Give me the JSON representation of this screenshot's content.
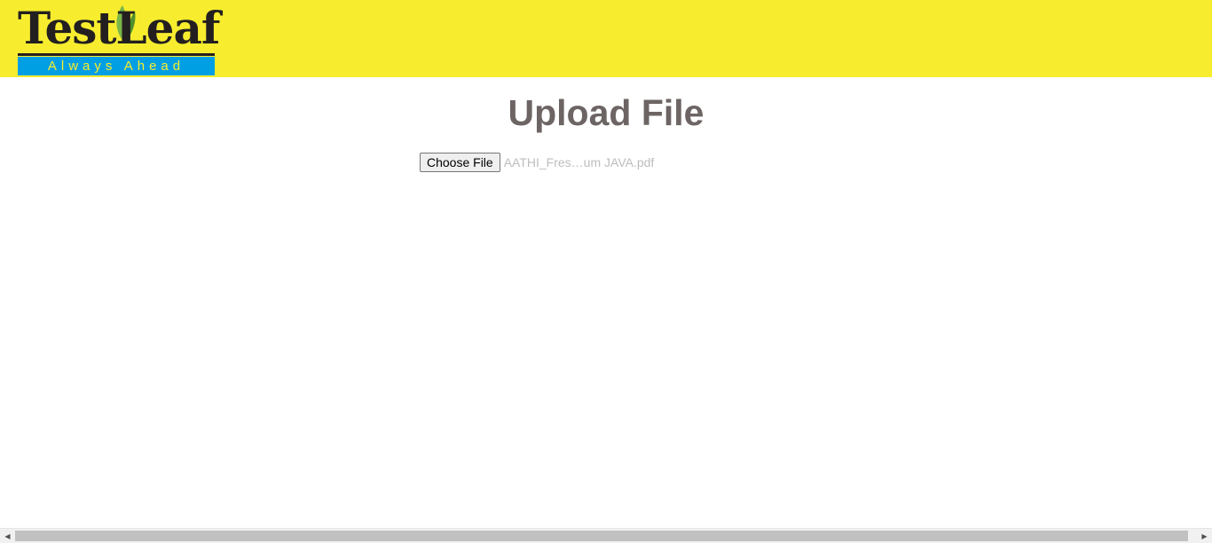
{
  "header": {
    "logo": {
      "brand_text": "TestLeaf",
      "tagline": "Always Ahead"
    },
    "background_color": "#f7ed2e"
  },
  "main": {
    "title": "Upload File",
    "file_input": {
      "button_label": "Choose File",
      "selected_file": "AATHI_Fres…um JAVA.pdf"
    }
  },
  "scrollbar": {
    "left_arrow_icon": "arrow-left-icon",
    "right_arrow_icon": "arrow-right-icon"
  }
}
